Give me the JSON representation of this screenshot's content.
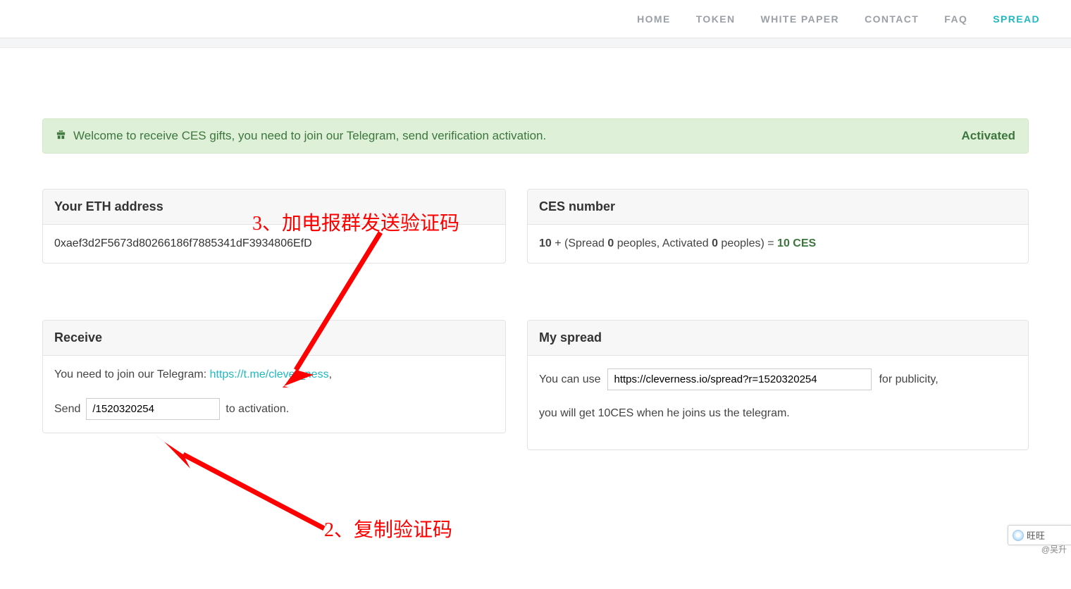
{
  "nav": {
    "items": [
      "HOME",
      "TOKEN",
      "WHITE PAPER",
      "CONTACT",
      "FAQ",
      "SPREAD"
    ],
    "active_index": 5
  },
  "alert": {
    "text": "Welcome to receive CES gifts, you need to join our Telegram, send verification activation.",
    "status": "Activated"
  },
  "eth": {
    "title": "Your ETH address",
    "address": "0xaef3d2F5673d80266186f7885341dF3934806EfD"
  },
  "ces": {
    "title": "CES number",
    "base": "10",
    "plus": " + (Spread ",
    "spread_peoples": "0",
    "mid1": " peoples, Activated ",
    "activated_peoples": "0",
    "mid2": " peoples) = ",
    "total": "10 CES"
  },
  "receive": {
    "title": "Receive",
    "pre_link": "You need to join our Telegram: ",
    "telegram_link": "https://t.me/clever_ness",
    "post_link": ",",
    "send_label": "Send",
    "code_value": "/1520320254",
    "send_suffix": " to activation."
  },
  "spread": {
    "title": "My spread",
    "use_label": "You can use",
    "url_value": "https://cleverness.io/spread?r=1520320254",
    "use_suffix": "for publicity,",
    "line2": "you will get 10CES when he joins us the telegram."
  },
  "annotations": {
    "top": "3、加电报群发送验证码",
    "bottom": "2、复制验证码"
  },
  "chat_widget": {
    "label": "旺旺",
    "handle": "@吴升"
  }
}
